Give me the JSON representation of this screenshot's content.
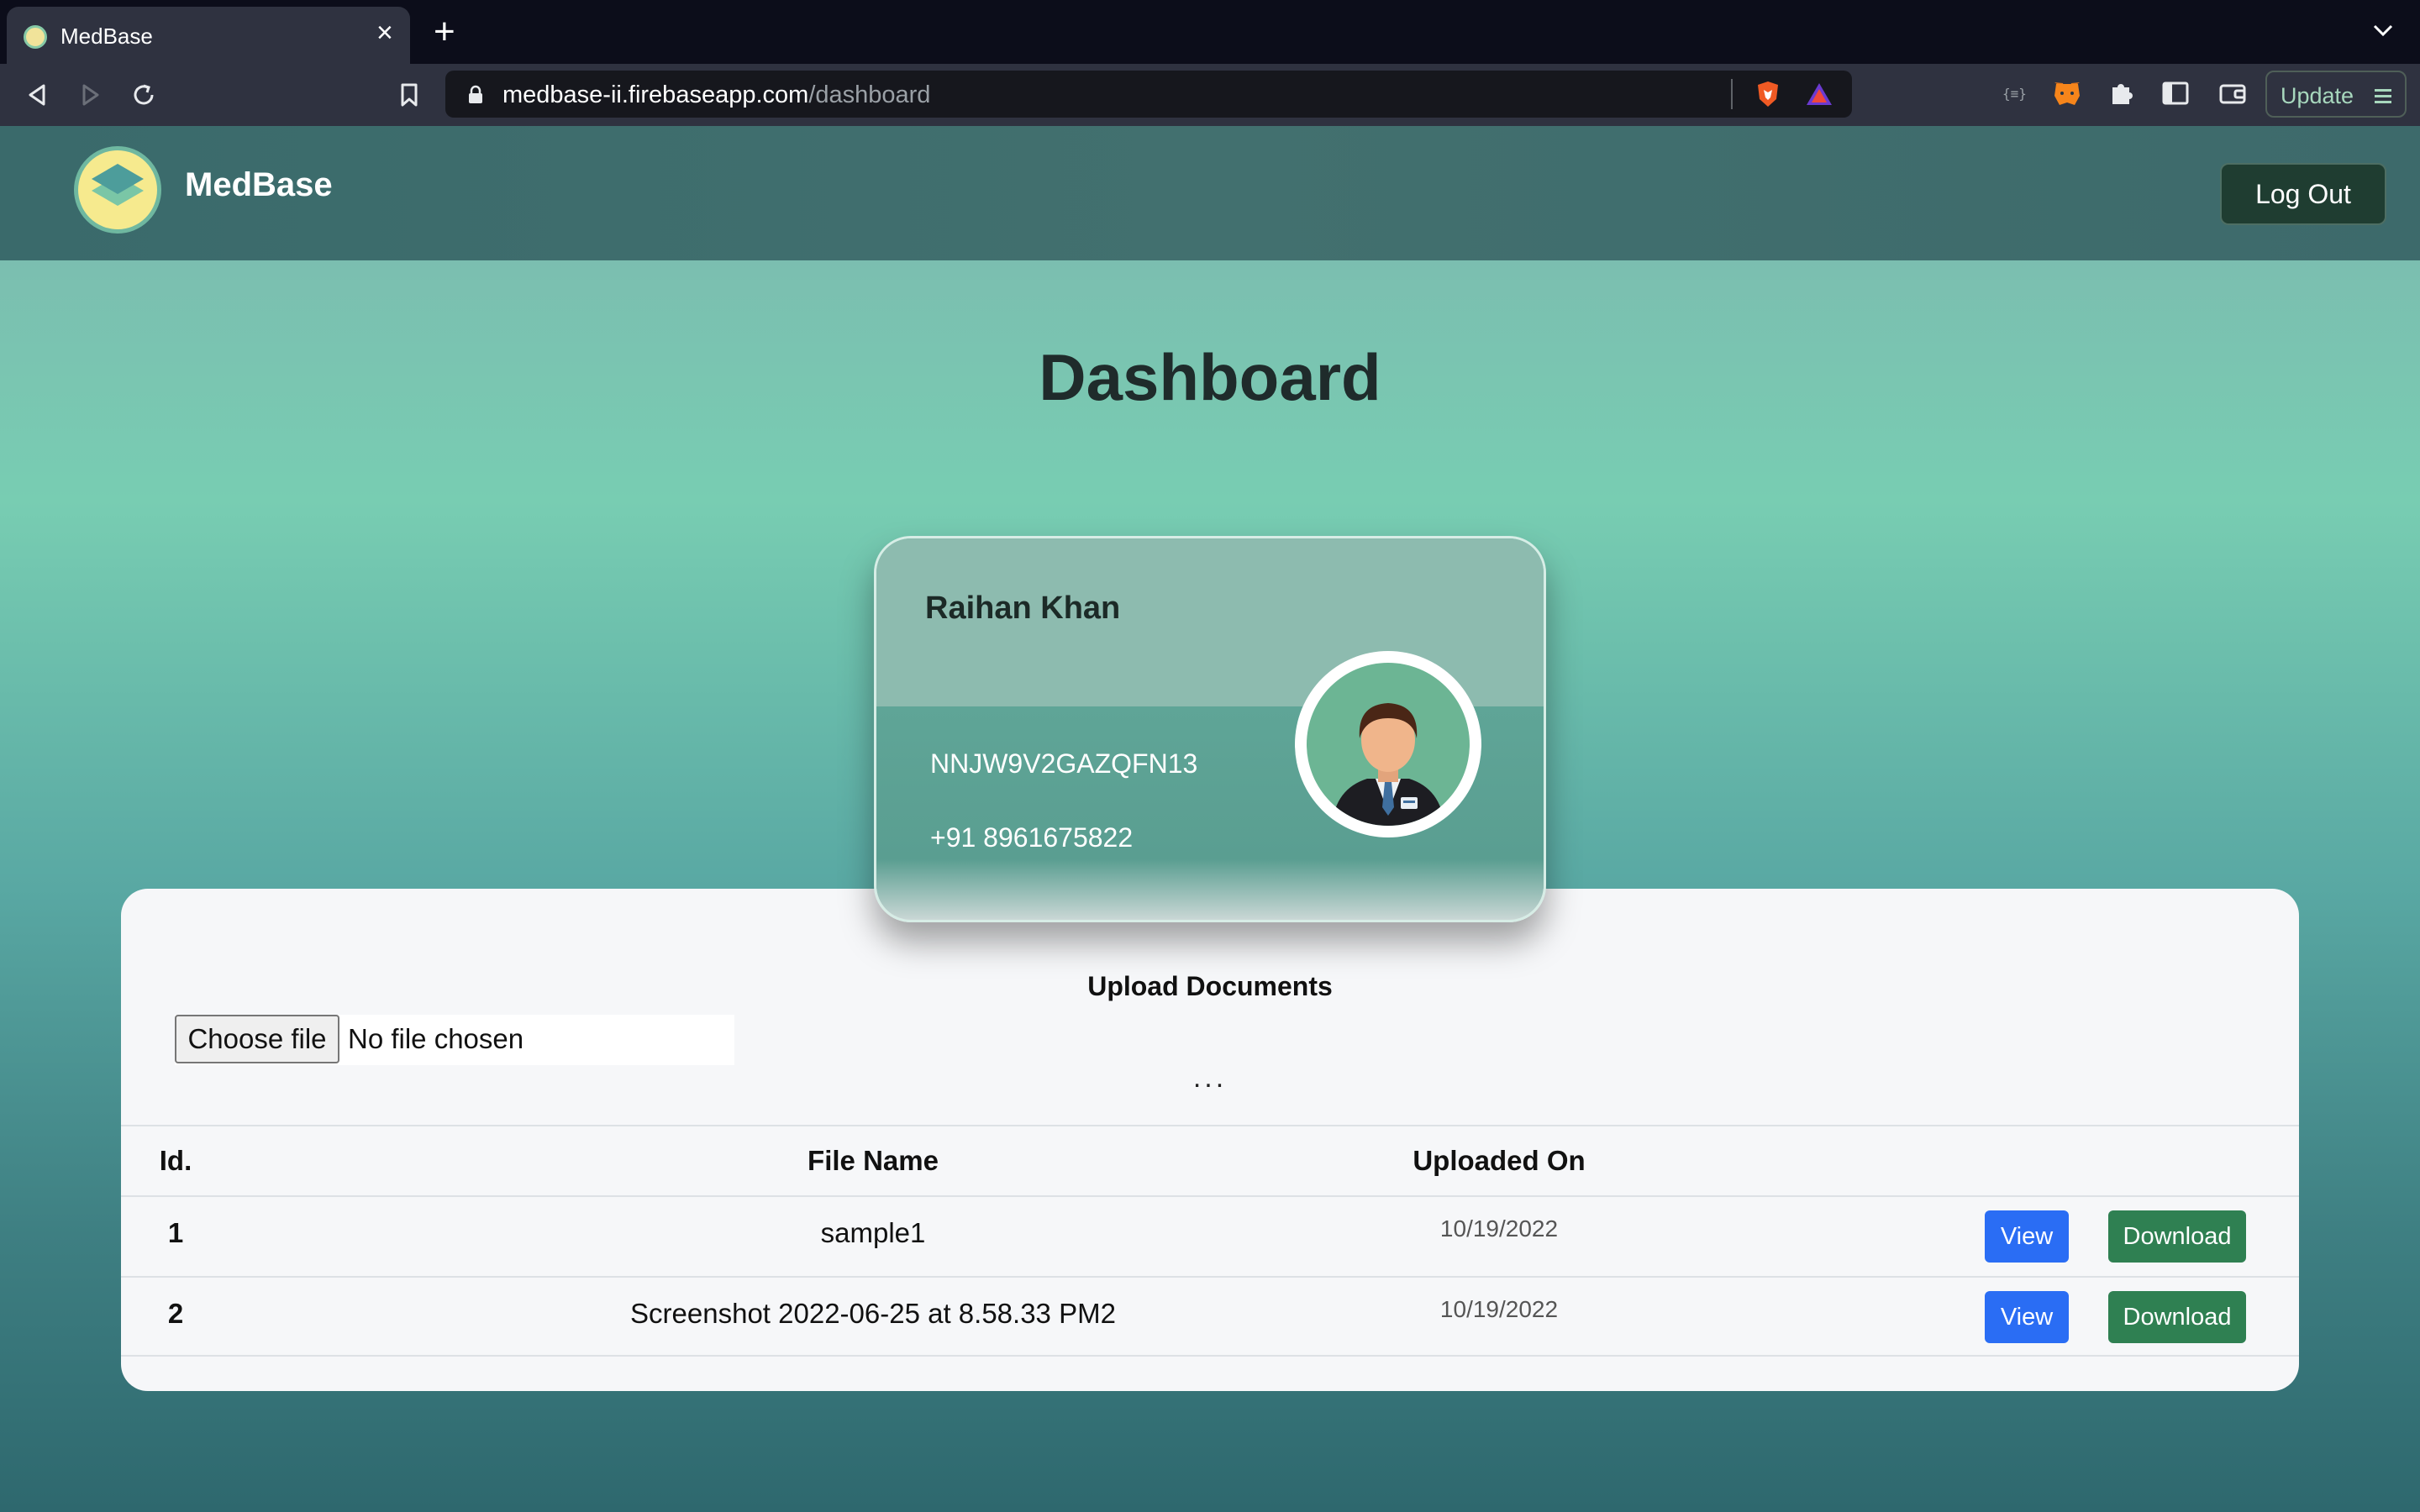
{
  "browser": {
    "tab_title": "MedBase",
    "url_host": "medbase-ii.firebaseapp.com",
    "url_path": "/dashboard",
    "update_label": "Update"
  },
  "nav": {
    "brand": "MedBase",
    "logout_label": "Log Out"
  },
  "page": {
    "title": "Dashboard"
  },
  "profile": {
    "name": "Raihan Khan",
    "id": "NNJW9V2GAZQFN13",
    "phone": "+91 8961675822"
  },
  "upload": {
    "title": "Upload Documents",
    "choose_label": "Choose file",
    "status": "No file chosen",
    "dots": "..."
  },
  "table": {
    "headers": {
      "id": "Id.",
      "name": "File Name",
      "date": "Uploaded On"
    },
    "rows": [
      {
        "id": "1",
        "name": "sample1",
        "date": "10/19/2022",
        "view": "View",
        "download": "Download"
      },
      {
        "id": "2",
        "name": "Screenshot 2022-06-25 at 8.58.33 PM2",
        "date": "10/19/2022",
        "view": "View",
        "download": "Download"
      }
    ]
  },
  "colors": {
    "accent_view": "#2a6df4",
    "accent_download": "#2f8052",
    "navbar": "#42706f"
  }
}
